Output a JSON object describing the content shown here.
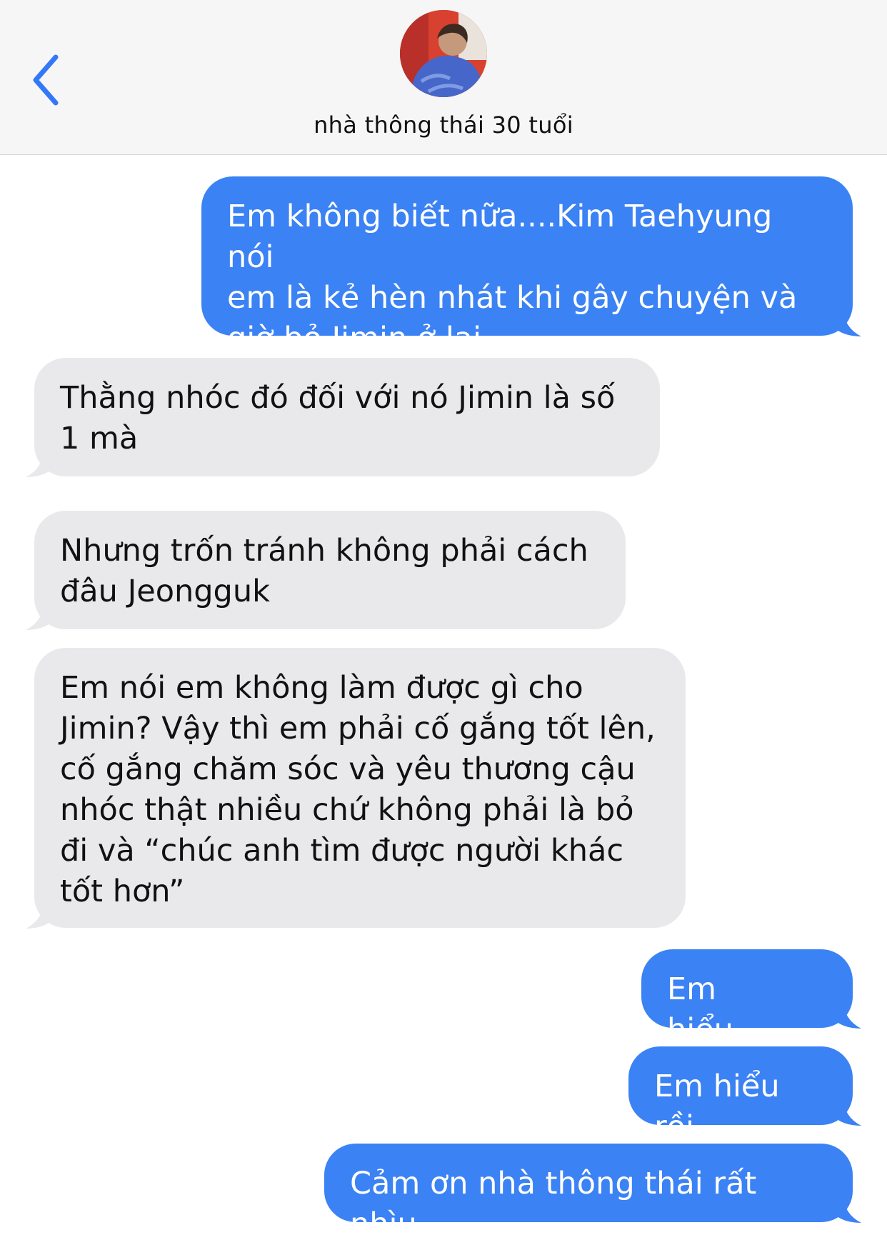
{
  "header": {
    "back_icon": "chevron-left-icon",
    "avatar": "contact-avatar",
    "contact_name": "nhà thông thái 30 tuổi"
  },
  "colors": {
    "outgoing": "#3b82f4",
    "incoming": "#e9e9eb",
    "accent": "#3478f6"
  },
  "messages": [
    {
      "direction": "out",
      "text": "Em không biết nữa....Kim Taehyung nói\nem là kẻ hèn nhát khi gây chuyện và\ngiờ bỏ Jimin ở lại"
    },
    {
      "direction": "in",
      "text": "Thằng nhóc đó đối với nó Jimin là số\n1 mà"
    },
    {
      "direction": "in",
      "text": "Nhưng trốn tránh không phải cách\nđâu Jeongguk"
    },
    {
      "direction": "in",
      "text": "Em nói em không làm được gì cho\nJimin? Vậy thì em phải cố gắng tốt lên,\ncố gắng chăm sóc và yêu thương cậu\nnhóc thật nhiều chứ không phải là bỏ\nđi và “chúc anh tìm được người khác\ntốt hơn”"
    },
    {
      "direction": "out",
      "text": "Em hiểu...."
    },
    {
      "direction": "out",
      "text": "Em hiểu rồi"
    },
    {
      "direction": "out",
      "text": "Cảm ơn nhà thông thái rất nhìu"
    }
  ]
}
